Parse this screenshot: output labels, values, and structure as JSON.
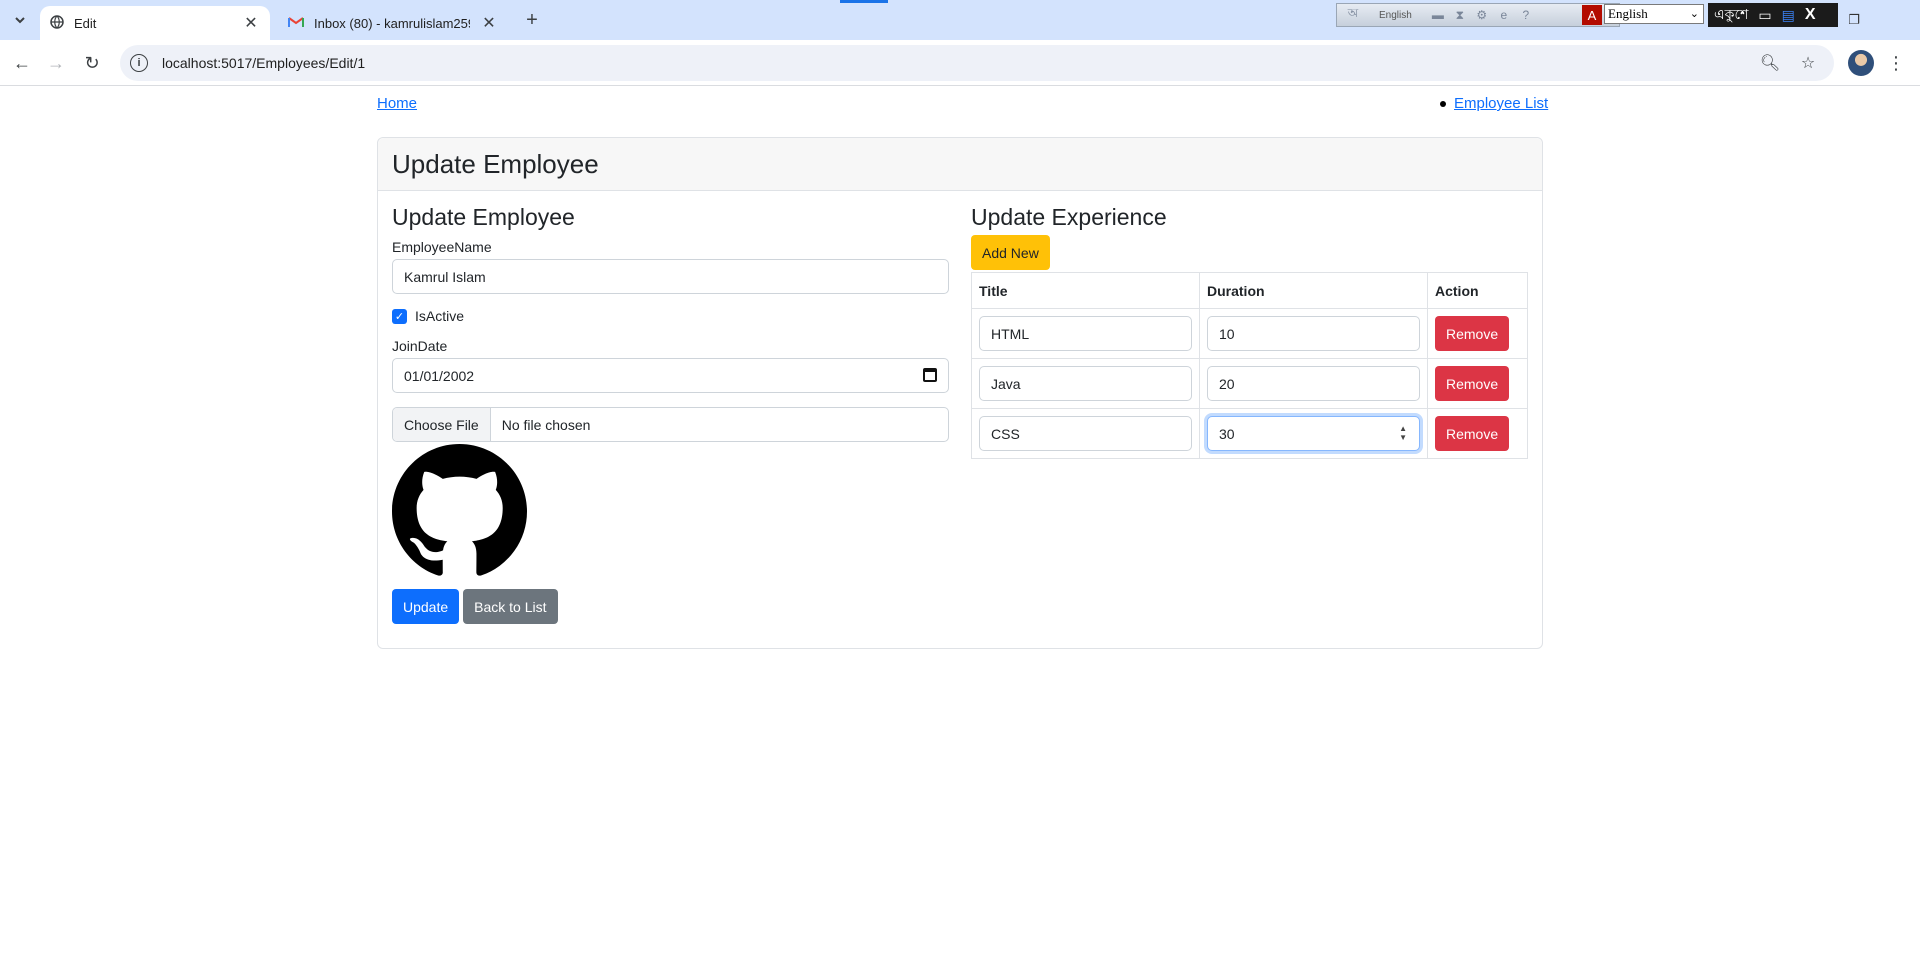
{
  "browser": {
    "tabs": [
      {
        "title": "Edit",
        "active": true
      },
      {
        "title": "Inbox (80) - kamrulislam25925",
        "active": false
      }
    ],
    "address": "localhost:5017/Employees/Edit/1",
    "language_toolbar": {
      "indicator": "English",
      "select_value": "English",
      "bangla_label": "একুশে"
    }
  },
  "nav": {
    "home": "Home",
    "employee_list": "Employee List"
  },
  "card": {
    "header_title": "Update Employee"
  },
  "employee_form": {
    "section_title": "Update Employee",
    "name_label": "EmployeeName",
    "name_value": "Kamrul Islam",
    "is_active_label": "IsActive",
    "is_active_checked": true,
    "join_date_label": "JoinDate",
    "join_date_value": "01/01/2002",
    "file_button": "Choose File",
    "file_status": "No file chosen",
    "image_icon": "github-icon",
    "update_button": "Update",
    "back_button": "Back to List"
  },
  "experience": {
    "section_title": "Update Experience",
    "add_button": "Add New",
    "columns": [
      "Title",
      "Duration",
      "Action"
    ],
    "rows": [
      {
        "title": "HTML",
        "duration": "10",
        "action": "Remove"
      },
      {
        "title": "Java",
        "duration": "20",
        "action": "Remove"
      },
      {
        "title": "CSS",
        "duration": "30",
        "action": "Remove"
      }
    ]
  },
  "colors": {
    "primary": "#0d6efd",
    "secondary": "#6c757d",
    "warning": "#ffc107",
    "danger": "#dc3545"
  }
}
